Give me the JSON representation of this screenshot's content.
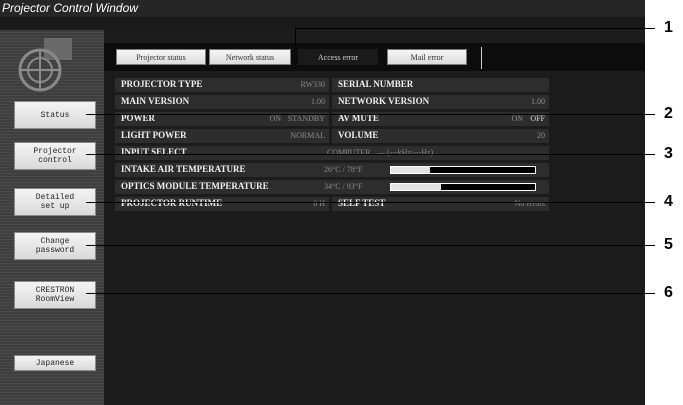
{
  "window": {
    "title": "Projector Control Window"
  },
  "sidebar": {
    "buttons": [
      {
        "label": "Status"
      },
      {
        "label": "Projector\ncontrol"
      },
      {
        "label": "Detailed\nset up"
      },
      {
        "label": "Change\npassword"
      },
      {
        "label": "CRESTRON\nRoomView"
      },
      {
        "label": "Japanese"
      }
    ]
  },
  "tabs": [
    {
      "label": "Projector status"
    },
    {
      "label": "Network status"
    },
    {
      "label": "Access error"
    },
    {
      "label": "Mail error"
    }
  ],
  "status": {
    "projector_type": {
      "label": "PROJECTOR TYPE",
      "value": "RW330"
    },
    "serial_number": {
      "label": "SERIAL NUMBER",
      "value": ""
    },
    "main_version": {
      "label": "MAIN VERSION",
      "value": "1.00"
    },
    "network_version": {
      "label": "NETWORK VERSION",
      "value": "1.00"
    },
    "power": {
      "label": "POWER",
      "on": "ON",
      "standby": "STANDBY"
    },
    "av_mute": {
      "label": "AV MUTE",
      "on": "ON",
      "off": "OFF"
    },
    "light_power": {
      "label": "LIGHT POWER",
      "value": "NORMAL"
    },
    "volume": {
      "label": "VOLUME",
      "value": "20"
    },
    "input_select": {
      "label": "INPUT SELECT",
      "value": "COMPUTER",
      "freq": "— (---kHz/---Hz)"
    },
    "intake_air_temp": {
      "label": "INTAKE AIR TEMPERATURE",
      "value": "26°C / 78°F",
      "level": 0.27
    },
    "optics_module_temp": {
      "label": "OPTICS MODULE TEMPERATURE",
      "value": "34°C / 93°F",
      "level": 0.35
    },
    "runtime": {
      "label": "PROJECTOR RUNTIME",
      "value": "6 H"
    },
    "self_test": {
      "label": "SELF TEST",
      "value": "No errors"
    }
  },
  "callouts": [
    "1",
    "2",
    "3",
    "4",
    "5",
    "6"
  ]
}
